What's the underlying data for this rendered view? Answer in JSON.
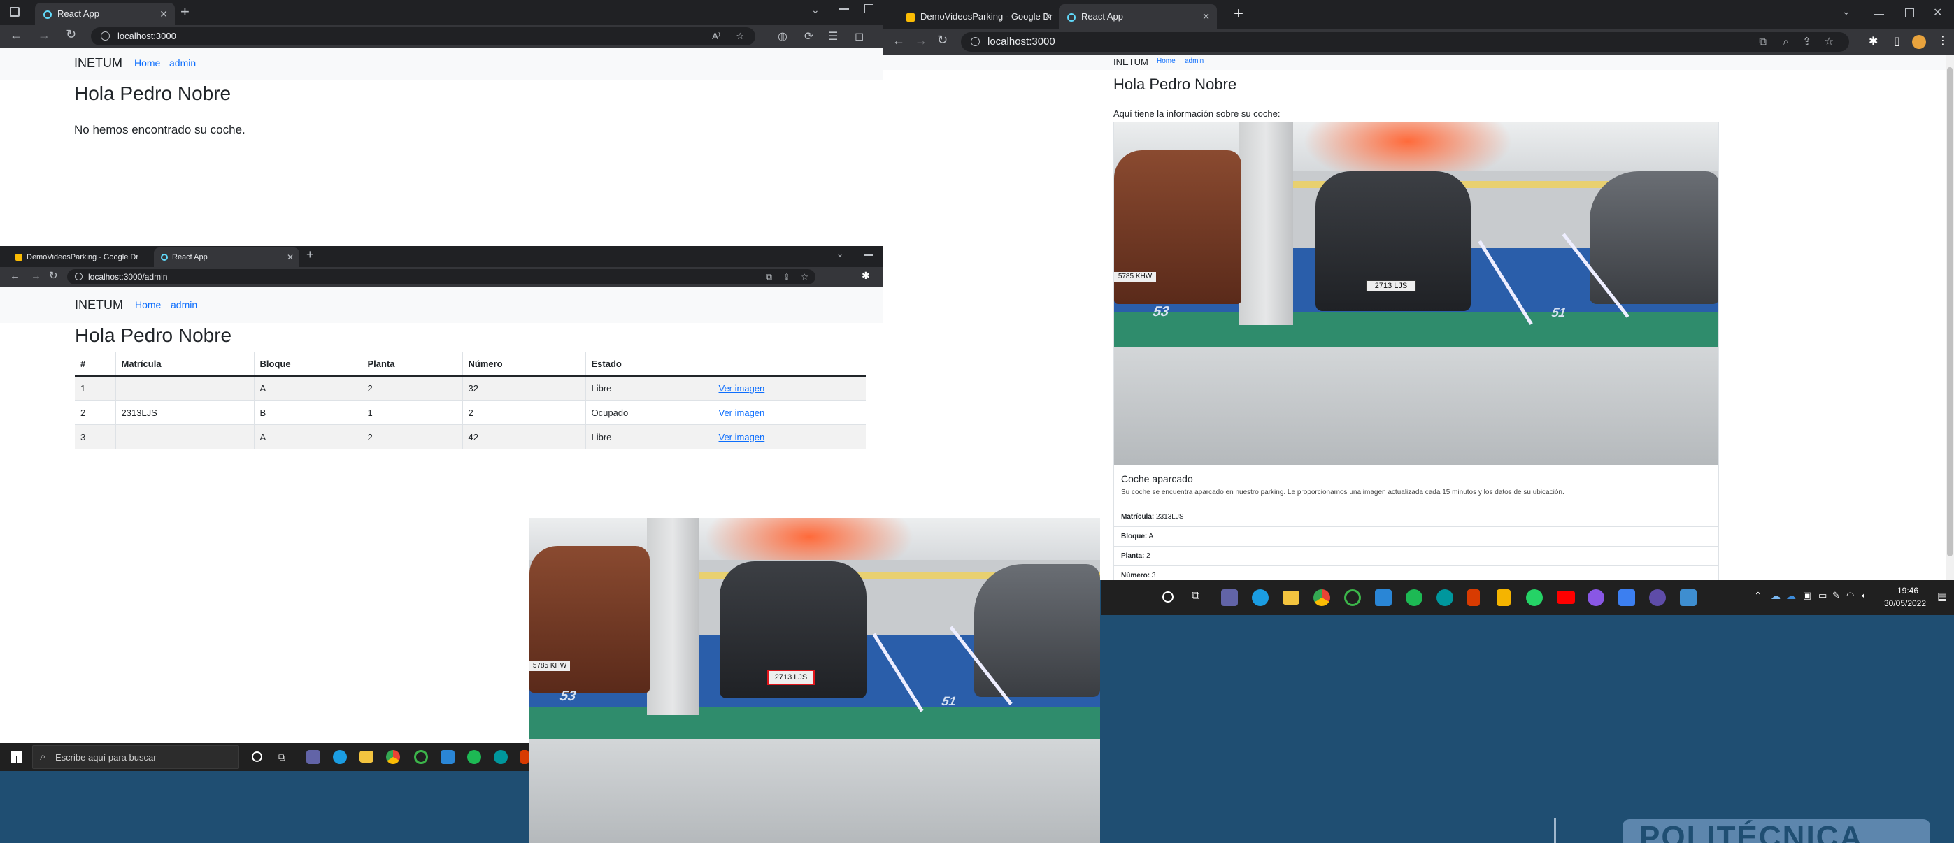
{
  "win_a": {
    "tabs": [
      {
        "label": "React App"
      }
    ],
    "url": "localhost:3000",
    "navbar": {
      "brand": "INETUM",
      "links": [
        "Home",
        "admin"
      ]
    },
    "heading": "Hola Pedro Nobre",
    "message": "No hemos encontrado su coche."
  },
  "win_b": {
    "tabs": [
      {
        "label": "DemoVideosParking - Google Dr"
      },
      {
        "label": "React App"
      }
    ],
    "url": "localhost:3000/admin",
    "navbar": {
      "brand": "INETUM",
      "links": [
        "Home",
        "admin"
      ]
    },
    "heading": "Hola Pedro Nobre",
    "table": {
      "headers": [
        "#",
        "Matrícula",
        "Bloque",
        "Planta",
        "Número",
        "Estado",
        ""
      ],
      "rows": [
        [
          "1",
          "",
          "A",
          "2",
          "32",
          "Libre",
          "Ver imagen"
        ],
        [
          "2",
          "2313LJS",
          "B",
          "1",
          "2",
          "Ocupado",
          "Ver imagen"
        ],
        [
          "3",
          "",
          "A",
          "2",
          "42",
          "Libre",
          "Ver imagen"
        ]
      ]
    }
  },
  "win_c": {
    "tabs": [
      {
        "label": "DemoVideosParking - Google Dr"
      },
      {
        "label": "React App"
      }
    ],
    "url": "localhost:3000",
    "navbar": {
      "brand": "INETUM",
      "links": [
        "Home",
        "admin"
      ]
    },
    "heading": "Hola Pedro Nobre",
    "intro": "Aquí tiene la información sobre su coche:",
    "card": {
      "title": "Coche aparcado",
      "text": "Su coche se encuentra aparcado en nuestro parking. Le proporcionamos una imagen actualizada cada 15 minutos y los datos de su ubicación.",
      "fields": [
        {
          "label": "Matrícula:",
          "value": "2313LJS"
        },
        {
          "label": "Bloque:",
          "value": "A"
        },
        {
          "label": "Planta:",
          "value": "2"
        },
        {
          "label": "Número:",
          "value": "3"
        }
      ]
    }
  },
  "photo": {
    "plate_text": "2713 LJS",
    "left_plate_text": "5785 KHW",
    "floor_numbers": [
      "53",
      "51"
    ]
  },
  "taskbar_left": {
    "search_placeholder": "Escribe aquí para buscar"
  },
  "taskbar_right": {
    "time": "19:46",
    "date": "30/05/2022"
  },
  "background_text": "POLITÉCNICA",
  "colors": {
    "accent": "#0d6efd",
    "chrome_dark": "#202124",
    "chrome_toolbar": "#35363a",
    "desktop": "#1f4e72"
  }
}
